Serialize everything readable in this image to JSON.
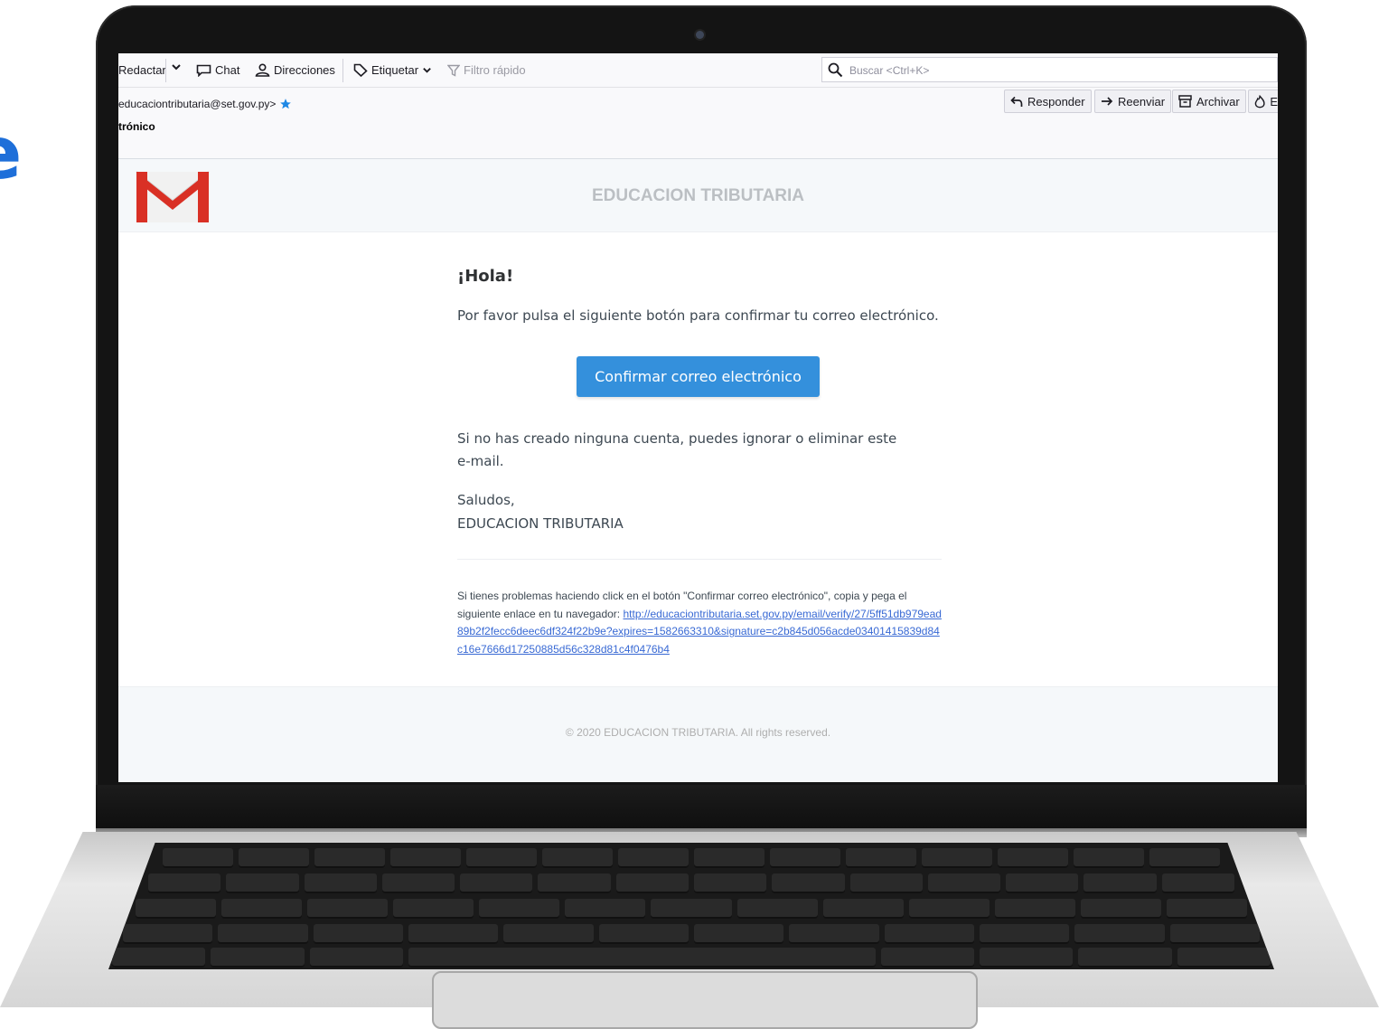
{
  "toolbar": {
    "compose": "Redactar",
    "chat": "Chat",
    "address_book": "Direcciones",
    "tag": "Etiquetar",
    "quick_filter": "Filtro rápido",
    "search_placeholder": "Buscar <Ctrl+K>"
  },
  "message_header": {
    "from": "educaciontributaria@set.gov.py>",
    "subject": "trónico",
    "actions": {
      "reply": "Responder",
      "forward": "Reenviar",
      "archive": "Archivar",
      "junk": "E"
    }
  },
  "email": {
    "banner_title": "EDUCACION TRIBUTARIA",
    "greeting": "¡Hola!",
    "intro": "Por favor pulsa el siguiente botón para confirmar tu correo electrónico.",
    "button_label": "Confirmar correo electrónico",
    "ignore_note": "Si no has creado ninguna cuenta, puedes ignorar o eliminar este e-mail.",
    "regards": "Saludos,",
    "signature": "EDUCACION TRIBUTARIA",
    "trouble_text": "Si tienes problemas haciendo click en el botón \"Confirmar correo electrónico\", copia y pega el siguiente enlace en tu navegador:",
    "verify_url": "http://educaciontributaria.set.gov.py/email/verify/27/5ff51db979ead89b2f2fecc6deec6df324f22b9e?expires=1582663310&signature=c2b845d056acde03401415839d84c16e7666d17250885d56c328d81c4f0476b4",
    "footer": "© 2020 EDUCACION TRIBUTARIA. All rights reserved."
  },
  "colors": {
    "button": "#3490dc",
    "link": "#3869d4",
    "star": "#1e88e5",
    "gmail_red": "#d93025"
  }
}
